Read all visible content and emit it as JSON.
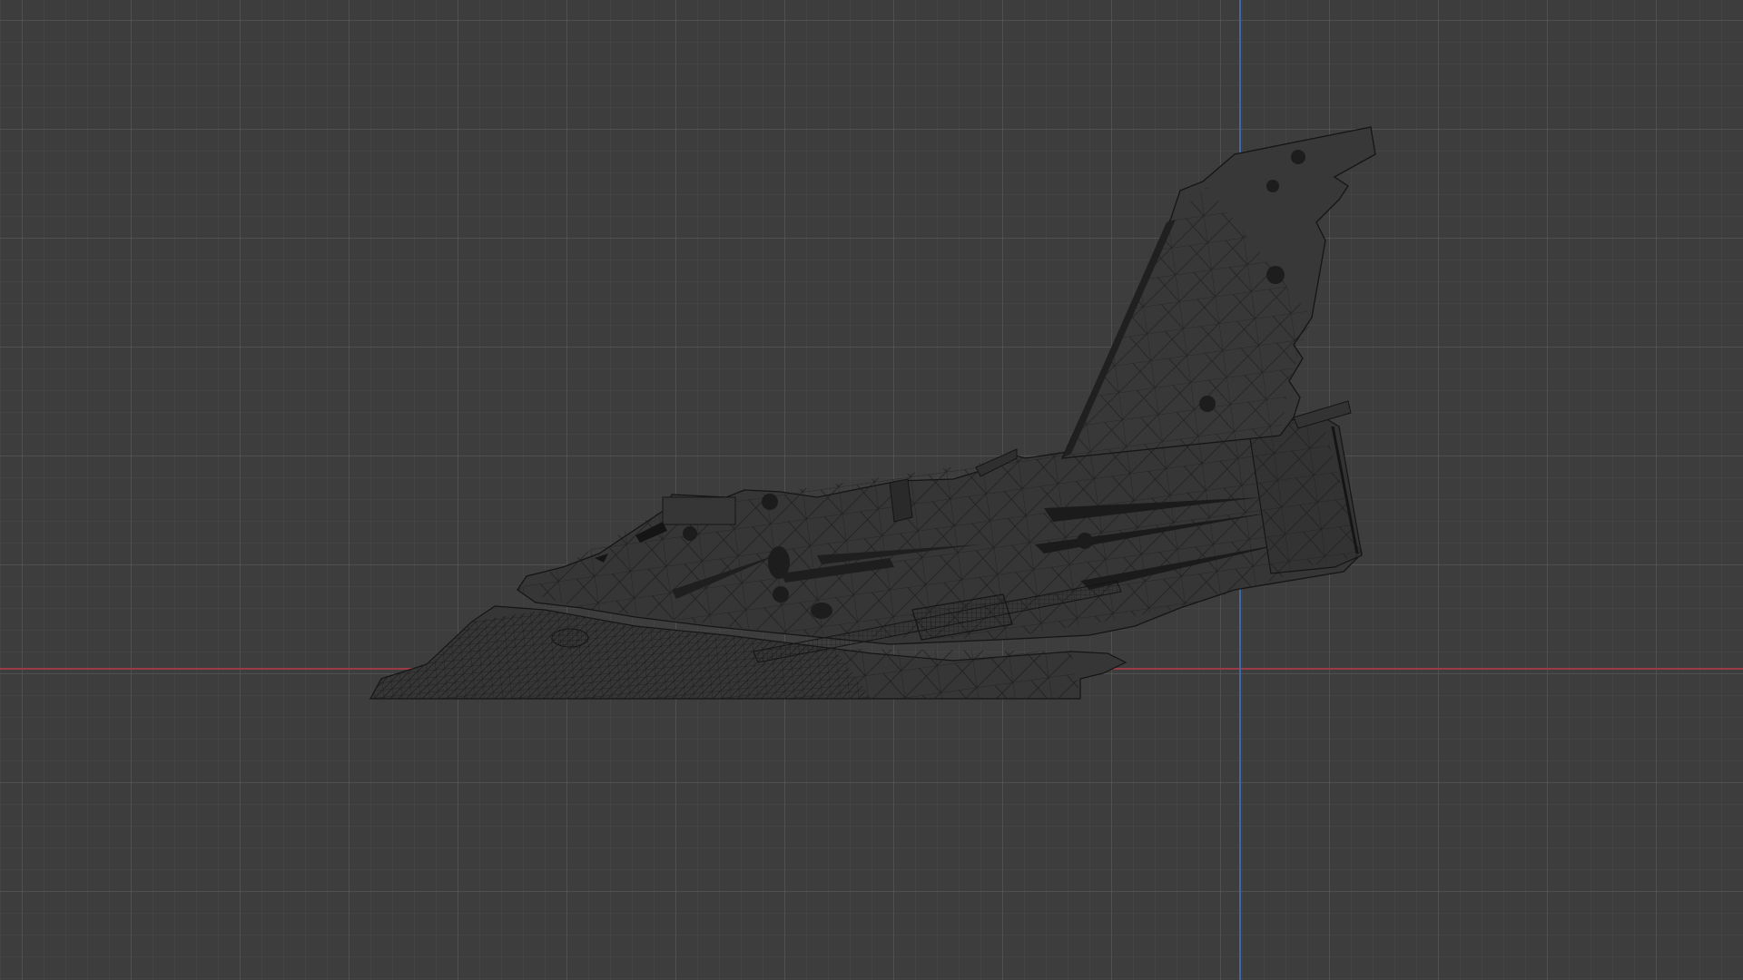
{
  "viewport": {
    "background_color": "#3d3d3d",
    "grid_color": "#5a5a5a",
    "x_axis_color": "#9b3b47",
    "z_axis_color": "#3f68a6"
  },
  "object": {
    "display_mode": "wireframe",
    "fill_color": "#363636",
    "wire_color": "#151515"
  }
}
